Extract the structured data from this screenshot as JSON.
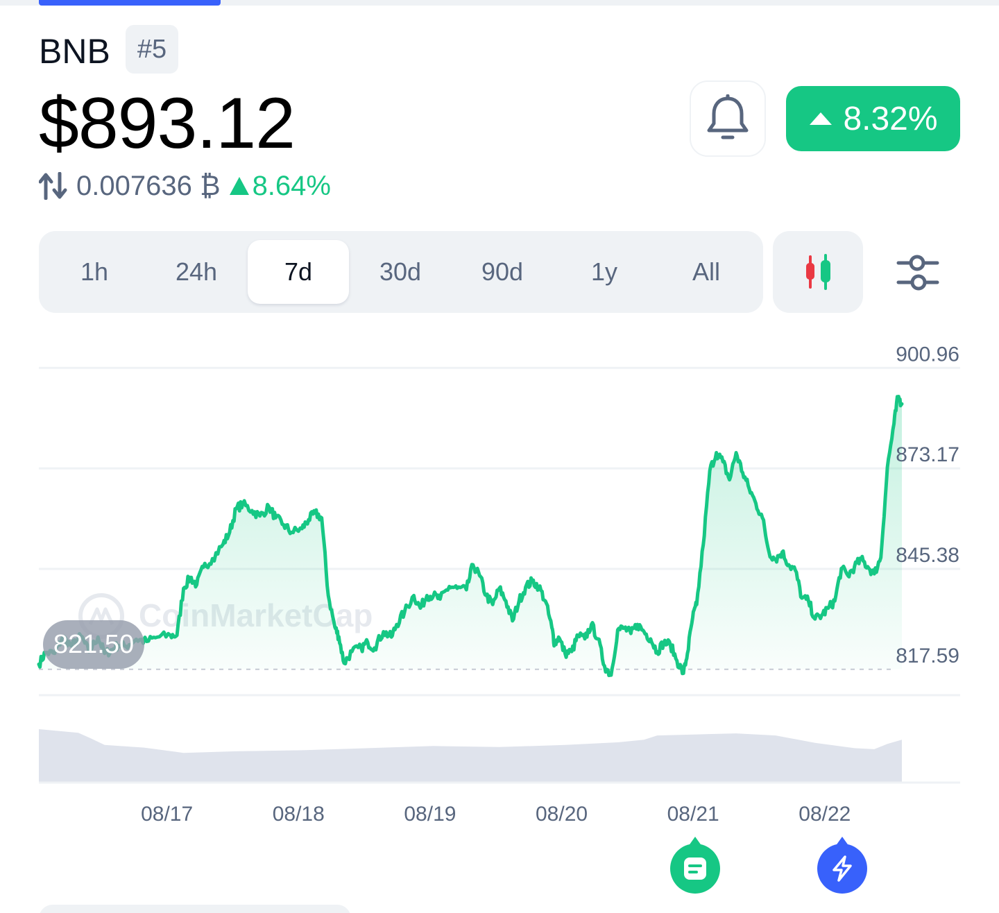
{
  "coin": {
    "name": "BNB",
    "rank": "#5",
    "price": "$893.12",
    "btc_price": "0.007636 ₿",
    "btc_change": "8.64%",
    "change_24h": "8.32%"
  },
  "range_tabs": [
    {
      "label": "1h"
    },
    {
      "label": "24h"
    },
    {
      "label": "7d"
    },
    {
      "label": "30d"
    },
    {
      "label": "90d"
    },
    {
      "label": "1y"
    },
    {
      "label": "All"
    }
  ],
  "active_range": "7d",
  "colors": {
    "up": "#16c784",
    "down": "#ea3943",
    "accent": "#3861fb",
    "muted": "#58667e",
    "surface": "#eff2f5"
  },
  "icons": {
    "swap": "swap-vertical-icon",
    "btc_arrow": "triangle-up-icon",
    "bell": "bell-icon",
    "change_arrow": "caret-up-icon",
    "candles": "candlestick-icon",
    "settings": "sliders-icon",
    "news": "news-icon",
    "lightning": "lightning-icon"
  },
  "chart_data": {
    "type": "line",
    "watermark": "CoinMarketCap",
    "start_label": "821.50",
    "y_tick_labels": [
      "900.96",
      "873.17",
      "845.38",
      "817.59"
    ],
    "y_ticks": [
      900.96,
      873.17,
      845.38,
      817.59
    ],
    "ylim": [
      813.71,
      902.93
    ],
    "x_tick_labels": [
      "08/17",
      "08/18",
      "08/19",
      "08/20",
      "08/21",
      "08/22"
    ],
    "x_tick_index": [
      1,
      2,
      3,
      4,
      5,
      6
    ],
    "xlim": [
      0,
      6.56
    ],
    "baseline": 817.59,
    "series": [
      {
        "values": [
          [
            0.0,
            819.0
          ],
          [
            0.05,
            822.2
          ],
          [
            0.12,
            822.0
          ],
          [
            0.18,
            826.5
          ],
          [
            0.25,
            824.0
          ],
          [
            0.32,
            826.8
          ],
          [
            0.38,
            822.5
          ],
          [
            0.45,
            826.5
          ],
          [
            0.5,
            822.0
          ],
          [
            0.56,
            823.0
          ],
          [
            0.6,
            824.3
          ],
          [
            0.66,
            824.0
          ],
          [
            0.74,
            825.9
          ],
          [
            0.82,
            825.3
          ],
          [
            0.9,
            826.5
          ],
          [
            1.0,
            827.0
          ],
          [
            1.05,
            827.0
          ],
          [
            1.1,
            840.0
          ],
          [
            1.15,
            843.0
          ],
          [
            1.2,
            841.0
          ],
          [
            1.25,
            845.8
          ],
          [
            1.32,
            848.2
          ],
          [
            1.4,
            852.2
          ],
          [
            1.45,
            855.5
          ],
          [
            1.5,
            862.0
          ],
          [
            1.55,
            863.3
          ],
          [
            1.62,
            861.5
          ],
          [
            1.68,
            860.0
          ],
          [
            1.75,
            862.5
          ],
          [
            1.8,
            859.5
          ],
          [
            1.86,
            857.6
          ],
          [
            1.92,
            855.5
          ],
          [
            2.0,
            856.5
          ],
          [
            2.05,
            859.0
          ],
          [
            2.1,
            860.8
          ],
          [
            2.15,
            859.5
          ],
          [
            2.2,
            838.0
          ],
          [
            2.25,
            829.3
          ],
          [
            2.28,
            826.6
          ],
          [
            2.32,
            819.3
          ],
          [
            2.38,
            822.5
          ],
          [
            2.45,
            823.5
          ],
          [
            2.5,
            825.0
          ],
          [
            2.55,
            823.5
          ],
          [
            2.62,
            828.0
          ],
          [
            2.68,
            826.5
          ],
          [
            2.72,
            830.0
          ],
          [
            2.78,
            833.5
          ],
          [
            2.85,
            838.0
          ],
          [
            2.9,
            834.5
          ],
          [
            2.95,
            838.0
          ],
          [
            3.0,
            838.0
          ],
          [
            3.05,
            837.0
          ],
          [
            3.12,
            840.5
          ],
          [
            3.18,
            840.0
          ],
          [
            3.25,
            839.6
          ],
          [
            3.3,
            846.5
          ],
          [
            3.35,
            843.5
          ],
          [
            3.4,
            838.0
          ],
          [
            3.45,
            835.5
          ],
          [
            3.5,
            840.0
          ],
          [
            3.55,
            836.5
          ],
          [
            3.6,
            831.0
          ],
          [
            3.65,
            836.5
          ],
          [
            3.7,
            840.3
          ],
          [
            3.75,
            842.0
          ],
          [
            3.8,
            840.5
          ],
          [
            3.85,
            836.5
          ],
          [
            3.9,
            829.0
          ],
          [
            3.92,
            824.5
          ],
          [
            3.95,
            826.5
          ],
          [
            4.0,
            822.0
          ],
          [
            4.05,
            822.5
          ],
          [
            4.1,
            827.0
          ],
          [
            4.15,
            826.0
          ],
          [
            4.2,
            830.0
          ],
          [
            4.25,
            826.0
          ],
          [
            4.3,
            818.5
          ],
          [
            4.35,
            816.0
          ],
          [
            4.4,
            828.5
          ],
          [
            4.45,
            829.0
          ],
          [
            4.5,
            827.5
          ],
          [
            4.55,
            830.0
          ],
          [
            4.6,
            828.0
          ],
          [
            4.65,
            826.0
          ],
          [
            4.7,
            822.5
          ],
          [
            4.75,
            825.0
          ],
          [
            4.8,
            824.5
          ],
          [
            4.85,
            820.0
          ],
          [
            4.9,
            816.5
          ],
          [
            4.93,
            822.0
          ],
          [
            4.97,
            832.0
          ],
          [
            5.0,
            835.5
          ],
          [
            5.05,
            852.0
          ],
          [
            5.1,
            872.5
          ],
          [
            5.15,
            877.5
          ],
          [
            5.2,
            875.0
          ],
          [
            5.25,
            870.0
          ],
          [
            5.3,
            877.5
          ],
          [
            5.35,
            872.0
          ],
          [
            5.4,
            867.5
          ],
          [
            5.45,
            863.5
          ],
          [
            5.5,
            859.5
          ],
          [
            5.55,
            850.0
          ],
          [
            5.6,
            848.0
          ],
          [
            5.65,
            850.0
          ],
          [
            5.7,
            846.5
          ],
          [
            5.75,
            845.0
          ],
          [
            5.8,
            837.3
          ],
          [
            5.85,
            836.5
          ],
          [
            5.9,
            831.5
          ],
          [
            5.95,
            832.5
          ],
          [
            6.0,
            834.5
          ],
          [
            6.05,
            836.5
          ],
          [
            6.1,
            845.5
          ],
          [
            6.15,
            843.5
          ],
          [
            6.2,
            846.0
          ],
          [
            6.25,
            848.0
          ],
          [
            6.3,
            846.0
          ],
          [
            6.35,
            844.0
          ],
          [
            6.4,
            848.5
          ],
          [
            6.45,
            873.5
          ],
          [
            6.5,
            885.5
          ],
          [
            6.53,
            893.0
          ],
          [
            6.56,
            891.0
          ]
        ]
      }
    ],
    "volume": {
      "values": [
        [
          0.0,
          1.0
        ],
        [
          0.3,
          0.93
        ],
        [
          0.4,
          0.82
        ],
        [
          0.5,
          0.7
        ],
        [
          0.8,
          0.65
        ],
        [
          1.1,
          0.55
        ],
        [
          1.5,
          0.58
        ],
        [
          2.0,
          0.6
        ],
        [
          2.5,
          0.64
        ],
        [
          3.0,
          0.68
        ],
        [
          3.5,
          0.66
        ],
        [
          4.0,
          0.7
        ],
        [
          4.4,
          0.75
        ],
        [
          4.6,
          0.8
        ],
        [
          4.7,
          0.88
        ],
        [
          5.0,
          0.9
        ],
        [
          5.3,
          0.92
        ],
        [
          5.6,
          0.88
        ],
        [
          5.9,
          0.74
        ],
        [
          6.2,
          0.64
        ],
        [
          6.35,
          0.62
        ],
        [
          6.45,
          0.72
        ],
        [
          6.56,
          0.8
        ]
      ]
    }
  }
}
